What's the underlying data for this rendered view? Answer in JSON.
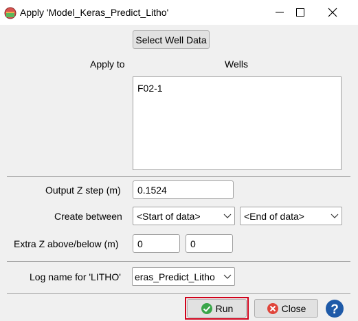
{
  "window": {
    "title": "Apply 'Model_Keras_Predict_Litho'",
    "controls": [
      "minimize",
      "maximize",
      "close"
    ]
  },
  "select_well_data_label": "Select Well Data",
  "apply_to": {
    "label": "Apply to",
    "header": "Wells",
    "items": [
      "F02-1"
    ]
  },
  "output_z_step": {
    "label": "Output Z step (m)",
    "value": "0.1524"
  },
  "create_between": {
    "label": "Create between",
    "start_value": "<Start of data>",
    "end_value": "<End of data>"
  },
  "extra_z": {
    "label": "Extra Z above/below (m)",
    "above": "0",
    "below": "0"
  },
  "log_name": {
    "label": "Log name for 'LITHO'",
    "value": "eras_Predict_Litho"
  },
  "buttons": {
    "run": "Run",
    "close": "Close",
    "help": "?"
  },
  "colors": {
    "accent_highlight": "#d0021b",
    "run_icon": "#3aa64a",
    "close_icon": "#e0453b",
    "help_icon": "#1e5aa8"
  }
}
